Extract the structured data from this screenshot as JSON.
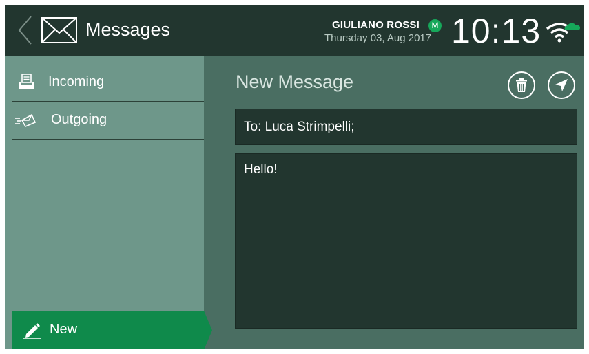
{
  "header": {
    "app_title": "Messages",
    "user_name": "GIULIANO ROSSI",
    "user_badge": "M",
    "date": "Thursday 03, Aug 2017",
    "time": "10:13"
  },
  "sidebar": {
    "items": [
      {
        "label": "Incoming",
        "icon": "inbox-tray-icon"
      },
      {
        "label": "Outgoing",
        "icon": "sending-envelope-icon"
      }
    ],
    "new_label": "New"
  },
  "compose": {
    "title": "New Message",
    "to": "To: Luca Strimpelli;",
    "body": "Hello!"
  },
  "colors": {
    "header_bg": "#22362f",
    "sidebar_bg": "#6e978a",
    "main_bg": "#4a6e62",
    "accent_green": "#16a85a",
    "new_button_bg": "#0f8a4b"
  }
}
